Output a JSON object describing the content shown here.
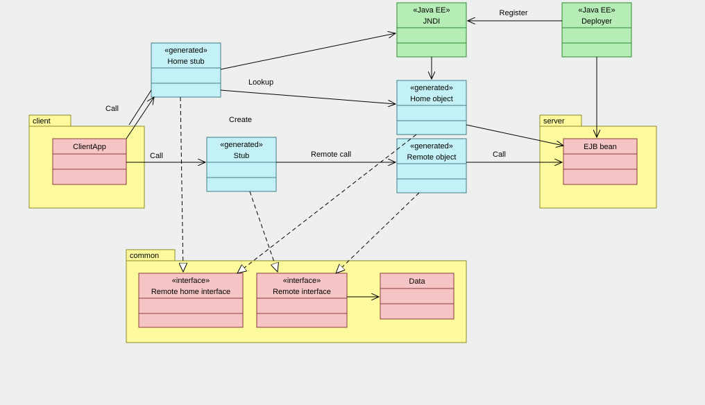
{
  "packages": {
    "client": {
      "name": "client"
    },
    "server": {
      "name": "server"
    },
    "common": {
      "name": "common"
    }
  },
  "classes": {
    "clientApp": {
      "title": "ClientApp"
    },
    "homeStub": {
      "stereotype": "«generated»",
      "title": "Home stub"
    },
    "stub": {
      "stereotype": "«generated»",
      "title": "Stub"
    },
    "jndi": {
      "stereotype": "«Java EE»",
      "title": "JNDI"
    },
    "deployer": {
      "stereotype": "«Java EE»",
      "title": "Deployer"
    },
    "homeObject": {
      "stereotype": "«generated»",
      "title": "Home object"
    },
    "remoteObject": {
      "stereotype": "«generated»",
      "title": "Remote object"
    },
    "ejbBean": {
      "title": "EJB bean"
    },
    "remoteHomeIf": {
      "stereotype": "«interface»",
      "title": "Remote home interface"
    },
    "remoteIf": {
      "stereotype": "«interface»",
      "title": "Remote interface"
    },
    "data": {
      "title": "Data"
    }
  },
  "edges": {
    "register": "Register",
    "lookup": "Lookup",
    "create": "Create",
    "callTop": "Call",
    "callLeft": "Call",
    "remoteCall": "Remote call",
    "callRight": "Call"
  }
}
